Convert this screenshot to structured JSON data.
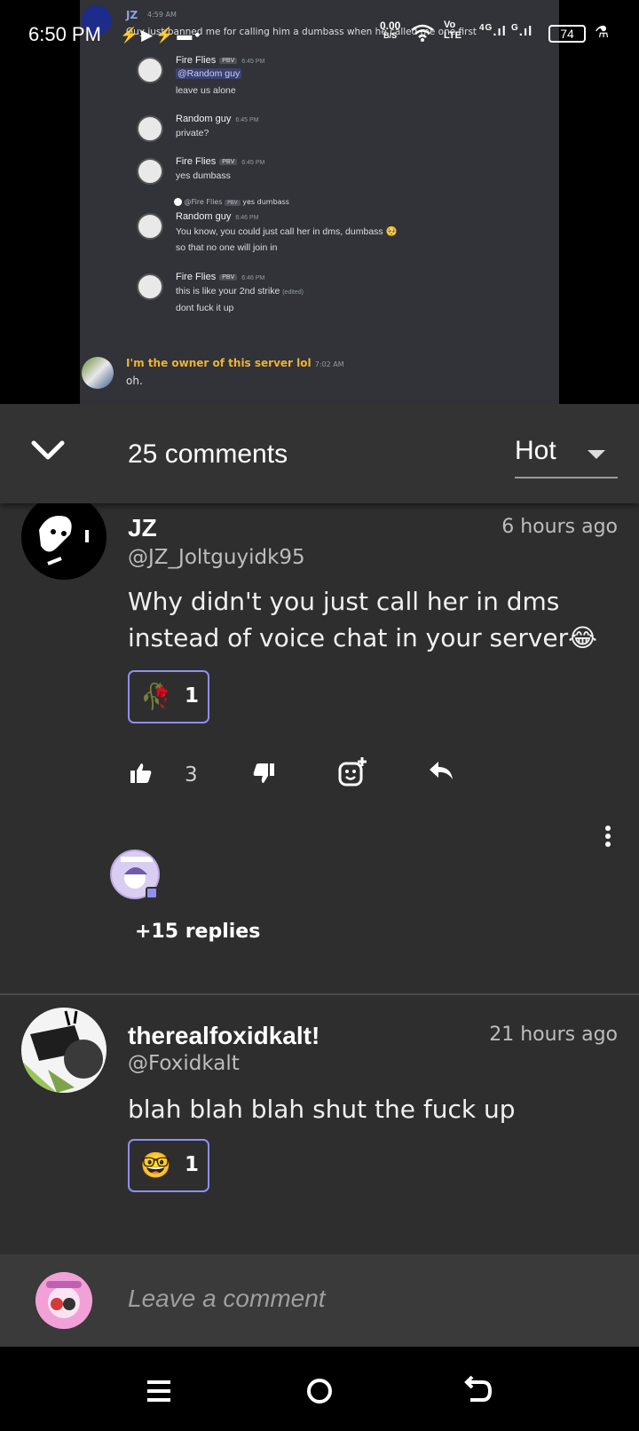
{
  "status_bar": {
    "time": "6:50 PM",
    "speed_value": "0.00",
    "speed_unit": "B/S",
    "vo_top": "Vo",
    "vo_bottom": "LTE",
    "net_4g": "4G",
    "signal_g": "G",
    "battery": "74"
  },
  "media": {
    "top_author": "JZ",
    "top_time": "4:59 AM",
    "top_text": "Guy just banned me for calling him a dumbass when he called me one first",
    "messages": [
      {
        "name": "Fire Flies",
        "tag": "PBV",
        "time": "6:45 PM",
        "mention": "@Random guy",
        "line1": "leave us alone"
      },
      {
        "name": "Random guy",
        "time": "6:45 PM",
        "line1": "private?"
      },
      {
        "name": "Fire Flies",
        "tag": "PBV",
        "time": "6:45 PM",
        "line1": "yes dumbass"
      },
      {
        "reply_name": "@Fire Flies",
        "reply_tag": "PBV",
        "reply_text": "yes dumbass",
        "name": "Random guy",
        "time": "6:46 PM",
        "line1": "You know, you could just call her in dms, dumbass",
        "line2": "so that no one will join in"
      },
      {
        "name": "Fire Flies",
        "tag": "PBV",
        "time": "6:46 PM",
        "line1": "this is like your 2nd strike",
        "edited": "(edited)",
        "line2": "dont fuck it up"
      },
      {
        "name": "I'm the owner of this server lol",
        "time": "7:02 AM",
        "line1": "oh."
      }
    ]
  },
  "header": {
    "count_label": "25 comments",
    "sort_label": "Hot"
  },
  "comments": [
    {
      "author": "JZ",
      "handle": "@JZ_Joltguyidk95",
      "time": "6 hours ago",
      "body": "Why didn't you just call her in dms instead of voice chat in your server😂",
      "reaction_emoji": "🥀",
      "reaction_count": "1",
      "like_count": "3",
      "replies_label": "+15 replies"
    },
    {
      "author": "therealfoxidkalt!",
      "handle": "@Foxidkalt",
      "time": "21 hours ago",
      "body": "blah blah blah shut the fuck up",
      "reaction_emoji": "🤓",
      "reaction_count": "1"
    }
  ],
  "composer": {
    "placeholder": "Leave a comment"
  },
  "colors": {
    "accent": "#8f8ff0",
    "background": "#2e2e2e",
    "owner_name": "#f0b232"
  }
}
